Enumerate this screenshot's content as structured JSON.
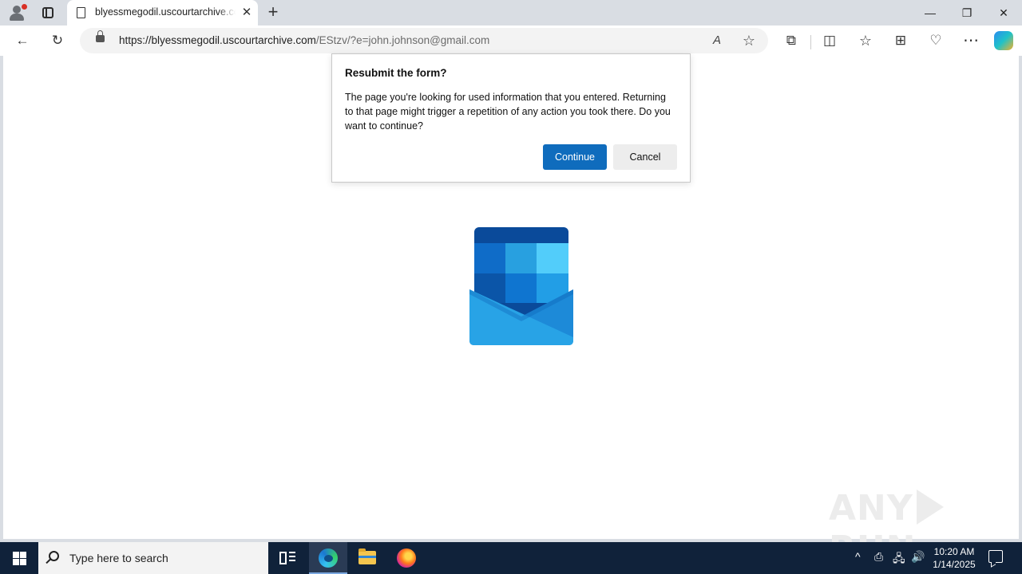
{
  "browser": {
    "tab_title": "blyessmegodil.uscourtarchive.com",
    "tab_close_glyph": "✕",
    "new_tab_glyph": "+",
    "window_controls": {
      "minimize": "—",
      "restore": "❐",
      "close": "✕"
    },
    "nav": {
      "back_glyph": "←",
      "refresh_glyph": "↻"
    },
    "address": {
      "host": "https://blyessmegodil.uscourtarchive.com",
      "path": "/EStzv/?e=john.johnson@gmail.com"
    },
    "address_icons": {
      "read_aloud": "A",
      "favorite": "☆"
    },
    "toolbar_icons": {
      "extensions": "⧉",
      "split_screen": "◫",
      "favorites": "☆",
      "collections": "⊞",
      "browser_essentials": "♡",
      "more": "⋯"
    }
  },
  "dialog": {
    "title": "Resubmit the form?",
    "message": "The page you're looking for used information that you entered. Returning to that page might trigger a repetition of any action you took there. Do you want to continue?",
    "continue_label": "Continue",
    "cancel_label": "Cancel"
  },
  "watermark": {
    "left": "ANY",
    "right": "RUN"
  },
  "taskbar": {
    "search_placeholder": "Type here to search",
    "tray": {
      "chevron": "^",
      "network": "🖧",
      "volume": "🔊",
      "meet": "⎙"
    },
    "clock_time": "10:20 AM",
    "clock_date": "1/14/2025"
  },
  "colors": {
    "accent": "#0f6cbd",
    "taskbar": "#10223a",
    "tabstrip": "#d9dde3"
  }
}
